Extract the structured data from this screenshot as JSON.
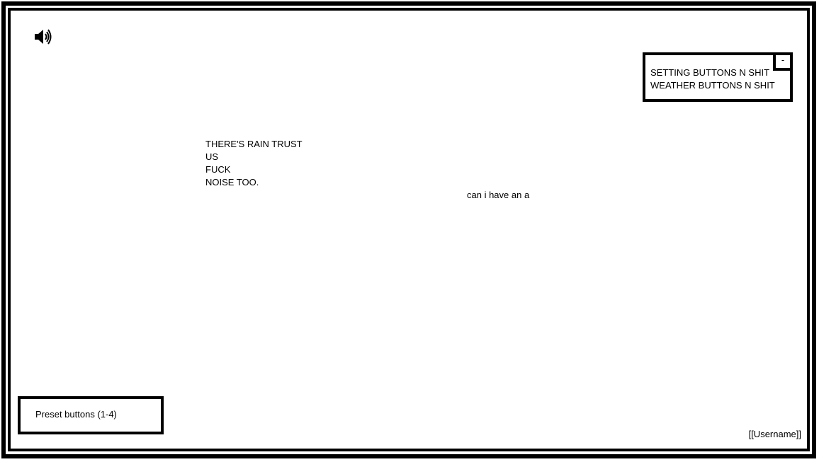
{
  "volume": {
    "icon": "speaker-volume-icon"
  },
  "settings_panel": {
    "lines": [
      "SETTING BUTTONS N SHIT",
      "WEATHER BUTTONS N SHIT"
    ],
    "minimize_label": "-"
  },
  "main": {
    "rain_lines": [
      "THERE'S RAIN TRUST",
      "US",
      "FUCK",
      "NOISE TOO."
    ],
    "center_note": "can i have an a"
  },
  "preset_panel": {
    "label": "Preset buttons (1-4)"
  },
  "footer": {
    "username": "[[Username]]"
  }
}
